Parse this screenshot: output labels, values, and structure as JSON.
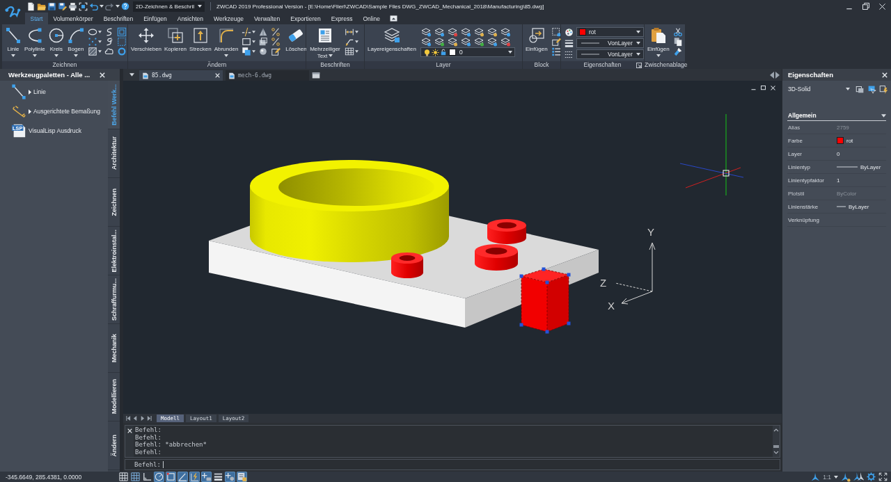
{
  "title_bar": {
    "workspace": "2D-Zeichnen & Beschril",
    "title": "ZWCAD 2019 Professional Version - [E:\\Home\\Flierl\\ZWCAD\\Sample Files DWG_ZWCAD_Mechanical_2018\\Manufacturing\\85.dwg]"
  },
  "ribbon_tabs": [
    {
      "label": "Start",
      "selected": true
    },
    {
      "label": "Volumenkörper",
      "selected": false
    },
    {
      "label": "Beschriften",
      "selected": false
    },
    {
      "label": "Einfügen",
      "selected": false
    },
    {
      "label": "Ansichten",
      "selected": false
    },
    {
      "label": "Werkzeuge",
      "selected": false
    },
    {
      "label": "Verwalten",
      "selected": false
    },
    {
      "label": "Exportieren",
      "selected": false
    },
    {
      "label": "Express",
      "selected": false
    },
    {
      "label": "Online",
      "selected": false
    }
  ],
  "ribbon_panels": [
    {
      "kind": "draw",
      "title": "Zeichnen",
      "tools": [
        {
          "kind": "line",
          "label": "Linie",
          "menu": true
        },
        {
          "kind": "polyline",
          "label": "Polylinie",
          "menu": true
        },
        {
          "kind": "circle",
          "label": "Kreis",
          "menu": true
        },
        {
          "kind": "arc",
          "label": "Bogen",
          "menu": true
        }
      ]
    },
    {
      "kind": "modify",
      "title": "Ändern",
      "tools": [
        {
          "kind": "move",
          "label": "Verschieben",
          "menu": false
        },
        {
          "kind": "copy",
          "label": "Kopieren",
          "menu": false
        },
        {
          "kind": "stretch",
          "label": "Strecken",
          "menu": false
        },
        {
          "kind": "fillet",
          "label": "Abrunden",
          "menu": true
        },
        {
          "kind": "erase",
          "label": "Löschen",
          "menu": false
        }
      ]
    },
    {
      "kind": "annotate",
      "title": "Beschriften",
      "tools": [
        {
          "kind": "mtext",
          "label": "Mehrzeiliger Text",
          "menu": true
        }
      ]
    },
    {
      "kind": "layer",
      "title": "Layer",
      "tools": [
        {
          "kind": "layers",
          "label": "Layereigenschaften",
          "menu": false
        }
      ],
      "layer_dropdown": {
        "value": "0",
        "color": "#ffffff"
      }
    },
    {
      "kind": "block",
      "title": "Block",
      "tools": [
        {
          "kind": "insert",
          "label": "Einfügen",
          "menu": false
        }
      ]
    },
    {
      "kind": "properties",
      "title": "Eigenschaften",
      "dropdowns": [
        {
          "kind": "color",
          "value": "rot",
          "color": "#ff0000"
        },
        {
          "kind": "lineweight",
          "value": "VonLayer"
        },
        {
          "kind": "linetype",
          "value": "VonLayer"
        }
      ]
    },
    {
      "kind": "clipboard",
      "title": "Zwischenablage",
      "tools": [
        {
          "kind": "paste",
          "label": "Einfügen",
          "menu": true
        }
      ]
    }
  ],
  "tool_palette": {
    "title": "Werkzeugpaletten - Alle ...",
    "items": [
      {
        "kind": "line",
        "label": "Linie",
        "flyout": true
      },
      {
        "kind": "dimension",
        "label": "Ausgerichtete Bemaßung",
        "flyout": true
      },
      {
        "kind": "lisp",
        "label": "VisualLisp Ausdruck",
        "flyout": false,
        "icon_text": "LSP"
      }
    ],
    "tabs": [
      {
        "label": "Befehl Werk...",
        "selected": true
      },
      {
        "label": "Architektur",
        "selected": false
      },
      {
        "label": "Zeichnen",
        "selected": false
      },
      {
        "label": "Elektroinstal...",
        "selected": false
      },
      {
        "label": "Schraffurmu...",
        "selected": false
      },
      {
        "label": "Mechanik",
        "selected": false
      },
      {
        "label": "Modellieren",
        "selected": false
      },
      {
        "label": "Ändern",
        "selected": false
      }
    ]
  },
  "document_tabs": [
    {
      "label": "85.dwg",
      "selected": true
    },
    {
      "label": "mech-6.dwg",
      "selected": false
    }
  ],
  "viewport": {
    "axis_labels": {
      "y": "Y",
      "z": "Z",
      "x": "X"
    }
  },
  "layout_tabs": [
    {
      "label": "Modell",
      "selected": true
    },
    {
      "label": "Layout1",
      "selected": false
    },
    {
      "label": "Layout2",
      "selected": false
    }
  ],
  "command_line": {
    "history": [
      "Befehl:",
      "Befehl:",
      "Befehl: *abbrechen*",
      "Befehl:"
    ],
    "prompt": "Befehl:"
  },
  "properties": {
    "title": "Eigenschaften",
    "object_type": "3D-Solid",
    "section": {
      "title": "Allgemein",
      "expanded": true
    },
    "rows": [
      {
        "kind": "text",
        "label": "Alias",
        "value": "2759",
        "disabled": true
      },
      {
        "kind": "color",
        "label": "Farbe",
        "value": "rot",
        "color": "#ff0000",
        "disabled": false
      },
      {
        "kind": "text",
        "label": "Layer",
        "value": "0",
        "disabled": false
      },
      {
        "kind": "linetype",
        "label": "Linientyp",
        "value": "ByLayer",
        "disabled": false
      },
      {
        "kind": "text",
        "label": "Linientypfaktor",
        "value": "1",
        "disabled": false
      },
      {
        "kind": "text",
        "label": "Plotstil",
        "value": "ByColor",
        "disabled": true
      },
      {
        "kind": "lineweight",
        "label": "Linienstärke",
        "value": "ByLayer",
        "disabled": false
      },
      {
        "kind": "text",
        "label": "Verknüpfung",
        "disabled": false
      }
    ]
  },
  "status_bar": {
    "coordinates": "-345.6649, 285.4381, 0.0000",
    "toggles": [
      {
        "kind": "grid",
        "on": false
      },
      {
        "kind": "snap",
        "on": false
      },
      {
        "kind": "ortho",
        "on": false
      },
      {
        "kind": "polar",
        "on": true
      },
      {
        "kind": "osnap",
        "on": true
      },
      {
        "kind": "otrack",
        "on": true
      },
      {
        "kind": "ducs",
        "on": true
      },
      {
        "kind": "dyn",
        "on": true
      },
      {
        "kind": "lineweight",
        "on": false
      },
      {
        "kind": "selection",
        "on": true
      },
      {
        "kind": "quickprops",
        "on": true
      }
    ],
    "annotation_scale": "1:1"
  }
}
